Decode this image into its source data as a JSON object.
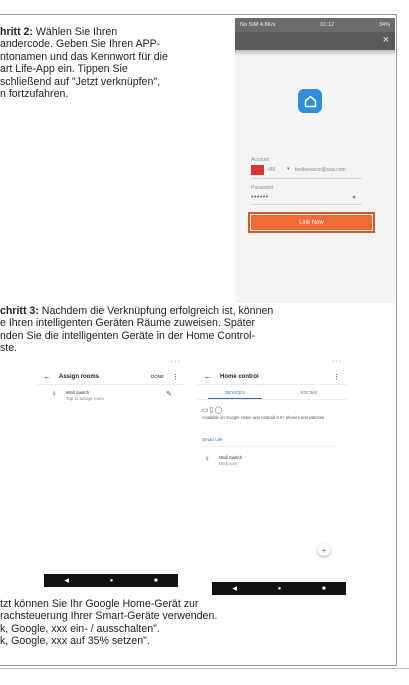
{
  "step2": {
    "label": "hritt 2:",
    "body": " Wählen Sie Ihren\nandercode. Geben Sie Ihren APP-\nntonamen und das Kennwort für die\nart Life-App ein. Tippen Sie\nschließend auf \"Jetzt verknüpfen\",\nn fortzufahren."
  },
  "phone1": {
    "status_left": "No SIM 4.8K/s",
    "status_time": "01:12",
    "status_right": "34%",
    "close": "×",
    "account_label": "Account",
    "country_code": "+86",
    "caret": "▾",
    "account_value": "testkenaccn@usa.com",
    "password_label": "Password",
    "password_value": "••••••",
    "link_button": "Link Now"
  },
  "step3": {
    "label": "chritt 3:",
    "body": " Nachdem die Verknüpfung erfolgreich ist, können\ne Ihren intelligenten Geräten Räume zuweisen. Später\nnden Sie die intelligenten Geräte in der Home Control-\nste."
  },
  "phone2": {
    "title": "Assign rooms",
    "done": "DONE",
    "device_name": "Wall Switch",
    "device_sub": "Tap to assign room"
  },
  "phone3": {
    "title": "Home control",
    "tab_devices": "DEVICES",
    "tab_rooms": "ROOMS",
    "note": "Available on Google Home and Android 6.0+ phones and watches",
    "provider": "Smart Life",
    "device_name": "Wall Switch",
    "device_room": "Bedroom",
    "fab": "+"
  },
  "final_text": "tzt können Sie Ihr Google Home-Gerät zur\nrachsteuerung Ihrer Smart-Geräte verwenden.\nk, Google, xxx ein- / ausschalten\".\nk, Google, xxx auf 35% setzen\".",
  "colors": {
    "link_button": "#f26a35",
    "link_border": "#e8521e",
    "app_logo": "#2f8fdc",
    "tab_active": "#3167c9"
  }
}
